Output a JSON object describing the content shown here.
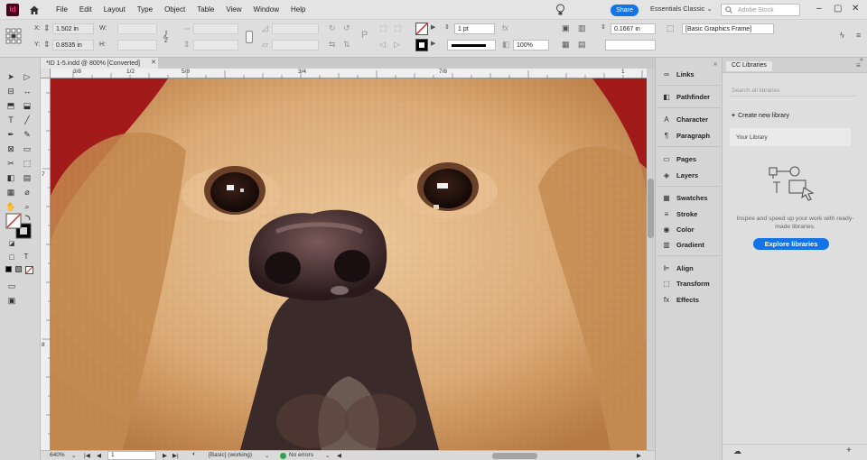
{
  "menu": {
    "logo": "Id",
    "items": [
      "File",
      "Edit",
      "Layout",
      "Type",
      "Object",
      "Table",
      "View",
      "Window",
      "Help"
    ],
    "share_label": "Share",
    "workspace": "Essentials Classic",
    "stock_placeholder": "Adobe Stock"
  },
  "control": {
    "x_label": "X:",
    "x_value": "1.502 in",
    "y_label": "Y:",
    "y_value": "0.8535 in",
    "w_label": "W:",
    "h_label": "H:",
    "stroke_weight": "1 pt",
    "opacity": "100%",
    "offset": "0.1667 in",
    "object_style": "[Basic Graphics Frame]"
  },
  "document": {
    "tab_title": "*ID 1-5.indd @ 800% [Converted]",
    "ruler_h_labels": [
      "3/8",
      "1/2",
      "5/8",
      "3/4",
      "7/8",
      "1"
    ],
    "ruler_v_labels": [
      "7",
      "8"
    ]
  },
  "status": {
    "zoom": "640%",
    "page": "1",
    "profile": "[Basic] (working)",
    "preflight": "No errors"
  },
  "panels": {
    "items": [
      "Links",
      "Pathfinder",
      "Character",
      "Paragraph",
      "Pages",
      "Layers",
      "Swatches",
      "Stroke",
      "Color",
      "Gradient",
      "Align",
      "Transform",
      "Effects"
    ]
  },
  "library": {
    "title": "CC Libraries",
    "search_placeholder": "Search all libraries",
    "create_label": "Create new library",
    "your_library": "Your Library",
    "inspire_text": "Inspire and speed up your work with ready-made libraries.",
    "explore_label": "Explore libraries"
  },
  "colors": {
    "accent": "#1473e6",
    "background_red": "#a01818",
    "fur": "#e0b383"
  }
}
